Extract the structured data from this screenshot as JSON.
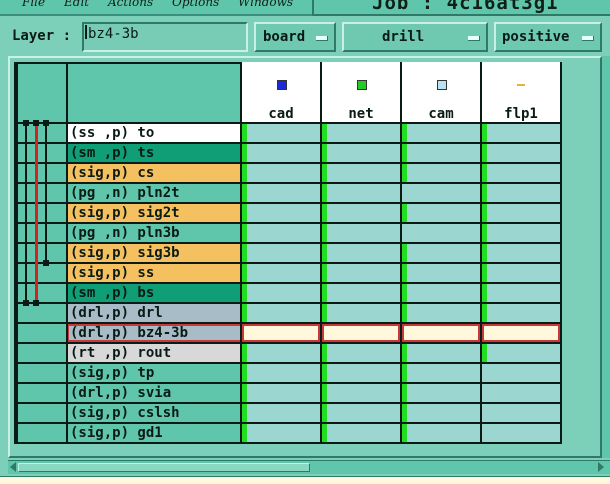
{
  "menubar": {
    "items": [
      "File",
      "Edit",
      "Actions",
      "Options",
      "Windows"
    ]
  },
  "job": {
    "title": "Job : 4c16at3g1"
  },
  "toolbar": {
    "layer_label": "Layer :",
    "layer_value": "bz4-3b",
    "dropdowns": [
      "board",
      "drill",
      "positive"
    ]
  },
  "columns": [
    {
      "name": "cad",
      "swatch": "#1a2ad8"
    },
    {
      "name": "net",
      "swatch": "#22cc22"
    },
    {
      "name": "cam",
      "swatch": "#b8e4f0"
    },
    {
      "name": "flp1",
      "swatch": "#e8b040"
    }
  ],
  "layers": [
    {
      "name": "(ss ,p) to",
      "bg": "#ffffff",
      "green": [
        true,
        true,
        true,
        true
      ]
    },
    {
      "name": "(sm ,p) ts",
      "bg": "#0f9e76",
      "green": [
        true,
        true,
        true,
        true
      ]
    },
    {
      "name": "(sig,p) cs",
      "bg": "#f5c060",
      "green": [
        true,
        true,
        true,
        true
      ]
    },
    {
      "name": "(pg ,n) pln2t",
      "bg": "#5fc6ab",
      "green": [
        true,
        true,
        false,
        true
      ]
    },
    {
      "name": "(sig,p) sig2t",
      "bg": "#f5c060",
      "green": [
        true,
        true,
        true,
        true
      ]
    },
    {
      "name": "(pg ,n) pln3b",
      "bg": "#5fc6ab",
      "green": [
        true,
        true,
        false,
        true
      ]
    },
    {
      "name": "(sig,p) sig3b",
      "bg": "#f5c060",
      "green": [
        true,
        true,
        true,
        true
      ]
    },
    {
      "name": "(sig,p) ss",
      "bg": "#f5c060",
      "green": [
        true,
        true,
        true,
        true
      ]
    },
    {
      "name": "(sm ,p) bs",
      "bg": "#0f9e76",
      "green": [
        true,
        true,
        true,
        true
      ]
    },
    {
      "name": "(drl,p) drl",
      "bg": "#a8bcc8",
      "green": [
        true,
        true,
        true,
        true
      ]
    },
    {
      "name": "(drl,p) bz4-3b",
      "bg": "#a8bcc8",
      "green": [
        false,
        false,
        false,
        false
      ],
      "selected": true
    },
    {
      "name": "(rt ,p) rout",
      "bg": "#d8d8d8",
      "green": [
        true,
        true,
        true,
        true
      ]
    },
    {
      "name": "(sig,p) tp",
      "bg": "#5fc6ab",
      "green": [
        true,
        true,
        true,
        false
      ]
    },
    {
      "name": "(drl,p) svia",
      "bg": "#5fc6ab",
      "green": [
        true,
        true,
        true,
        false
      ]
    },
    {
      "name": "(sig,p) cslsh",
      "bg": "#5fc6ab",
      "green": [
        true,
        true,
        true,
        false
      ]
    },
    {
      "name": "(sig,p) gd1",
      "bg": "#5fc6ab",
      "green": [
        true,
        true,
        true,
        false
      ]
    }
  ],
  "colors": {
    "background": "#7ccfb8",
    "selected_row_outline": "#c83a3a",
    "drill_span": "#d82020",
    "green_marker": "#22dd22"
  }
}
